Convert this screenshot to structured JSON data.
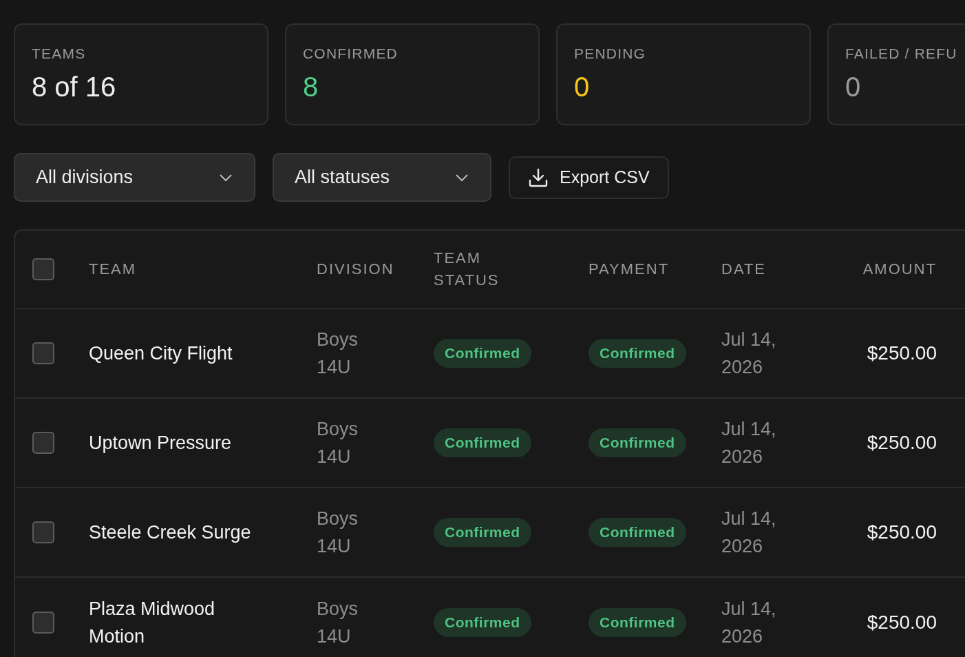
{
  "stats": [
    {
      "label": "TEAMS",
      "value": "8 of 16",
      "color": "#ededed"
    },
    {
      "label": "CONFIRMED",
      "value": "8",
      "color": "#4fd18b"
    },
    {
      "label": "PENDING",
      "value": "0",
      "color": "#f5c518"
    },
    {
      "label": "FAILED / REFU",
      "value": "0",
      "color": "#9a9a9a"
    }
  ],
  "filters": [
    {
      "value": "All divisions"
    },
    {
      "value": "All statuses"
    }
  ],
  "export_button": {
    "label": "Export CSV"
  },
  "table": {
    "select_all": {
      "checked": false
    },
    "columns": [
      "TEAM",
      "DIVISION",
      "TEAM STATUS",
      "PAYMENT",
      "DATE",
      "AMOUNT"
    ],
    "rows": [
      {
        "checked": false,
        "team": "Queen City Flight",
        "division": "Boys 14U",
        "team_status": "Confirmed",
        "payment": "Confirmed",
        "date": "Jul 14, 2026",
        "amount": "$250.00"
      },
      {
        "checked": false,
        "team": "Uptown Pressure",
        "division": "Boys 14U",
        "team_status": "Confirmed",
        "payment": "Confirmed",
        "date": "Jul 14, 2026",
        "amount": "$250.00"
      },
      {
        "checked": false,
        "team": "Steele Creek Surge",
        "division": "Boys 14U",
        "team_status": "Confirmed",
        "payment": "Confirmed",
        "date": "Jul 14, 2026",
        "amount": "$250.00"
      },
      {
        "checked": false,
        "team": "Plaza Midwood Motion",
        "division": "Boys 14U",
        "team_status": "Confirmed",
        "payment": "Confirmed",
        "date": "Jul 14, 2026",
        "amount": "$250.00"
      }
    ]
  }
}
